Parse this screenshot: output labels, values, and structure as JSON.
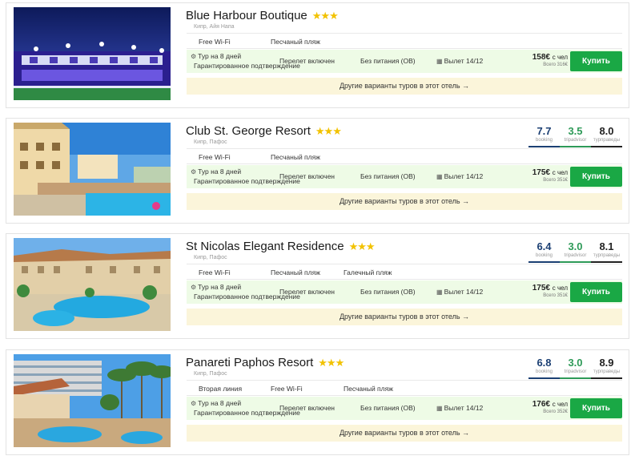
{
  "hotels": [
    {
      "name": "Blue Harbour Boutique",
      "stars": "★★★",
      "location": "Кипр, Айя Напа",
      "tags": [
        "Free Wi-Fi",
        "Песчаный пляж"
      ],
      "tour": "Тур на 8 дней",
      "guarantee": "Гарантированное подтверждение",
      "flight": "Перелет включен",
      "meal": "Без питания (OB)",
      "departure": "Вылет 14/12",
      "price": "158€",
      "price_unit": "с чел",
      "total": "Всего 316€",
      "buy_label": "Купить",
      "other_label": "Другие варианты туров в этот отель →",
      "ratings": []
    },
    {
      "name": "Club St. George Resort",
      "stars": "★★★",
      "location": "Кипр, Пафос",
      "tags": [
        "Free Wi-Fi",
        "Песчаный пляж"
      ],
      "tour": "Тур на 8 дней",
      "guarantee": "Гарантированное подтверждение",
      "flight": "Перелет включен",
      "meal": "Без питания (OB)",
      "departure": "Вылет 14/12",
      "price": "175€",
      "price_unit": "с чел",
      "total": "Всего 351€",
      "buy_label": "Купить",
      "other_label": "Другие варианты туров в этот отель →",
      "ratings": [
        {
          "value": "7.7",
          "label": "booking"
        },
        {
          "value": "3.5",
          "label": "tripadvisor"
        },
        {
          "value": "8.0",
          "label": "турправеды"
        }
      ]
    },
    {
      "name": "St Nicolas Elegant Residence",
      "stars": "★★★",
      "location": "Кипр, Пафос",
      "tags": [
        "Free Wi-Fi",
        "Песчаный пляж",
        "Галечный пляж"
      ],
      "tour": "Тур на 8 дней",
      "guarantee": "Гарантированное подтверждение",
      "flight": "Перелет включен",
      "meal": "Без питания (OB)",
      "departure": "Вылет 14/12",
      "price": "175€",
      "price_unit": "с чел",
      "total": "Всего 351€",
      "buy_label": "Купить",
      "other_label": "Другие варианты туров в этот отель →",
      "ratings": [
        {
          "value": "6.4",
          "label": "booking"
        },
        {
          "value": "3.0",
          "label": "tripadvisor"
        },
        {
          "value": "8.1",
          "label": "турправеды"
        }
      ]
    },
    {
      "name": "Panareti Paphos Resort",
      "stars": "★★★",
      "location": "Кипр, Пафос",
      "tags": [
        "Вторая линия",
        "Free Wi-Fi",
        "Песчаный пляж"
      ],
      "tour": "Тур на 8 дней",
      "guarantee": "Гарантированное подтверждение",
      "flight": "Перелет включен",
      "meal": "Без питания (OB)",
      "departure": "Вылет 14/12",
      "price": "176€",
      "price_unit": "с чел",
      "total": "Всего 352€",
      "buy_label": "Купить",
      "other_label": "Другие варианты туров в этот отель →",
      "ratings": [
        {
          "value": "6.8",
          "label": "booking"
        },
        {
          "value": "3.0",
          "label": "tripadvisor"
        },
        {
          "value": "8.9",
          "label": "турправеды"
        }
      ]
    }
  ],
  "colors": {
    "buy": "#1aa845",
    "tour_row": "#eefbe6",
    "other_row": "#fbf5da",
    "booking": "#1b3f73",
    "tripadvisor": "#2e9a58",
    "turpravdy": "#222222",
    "stars": "#f2c200"
  }
}
